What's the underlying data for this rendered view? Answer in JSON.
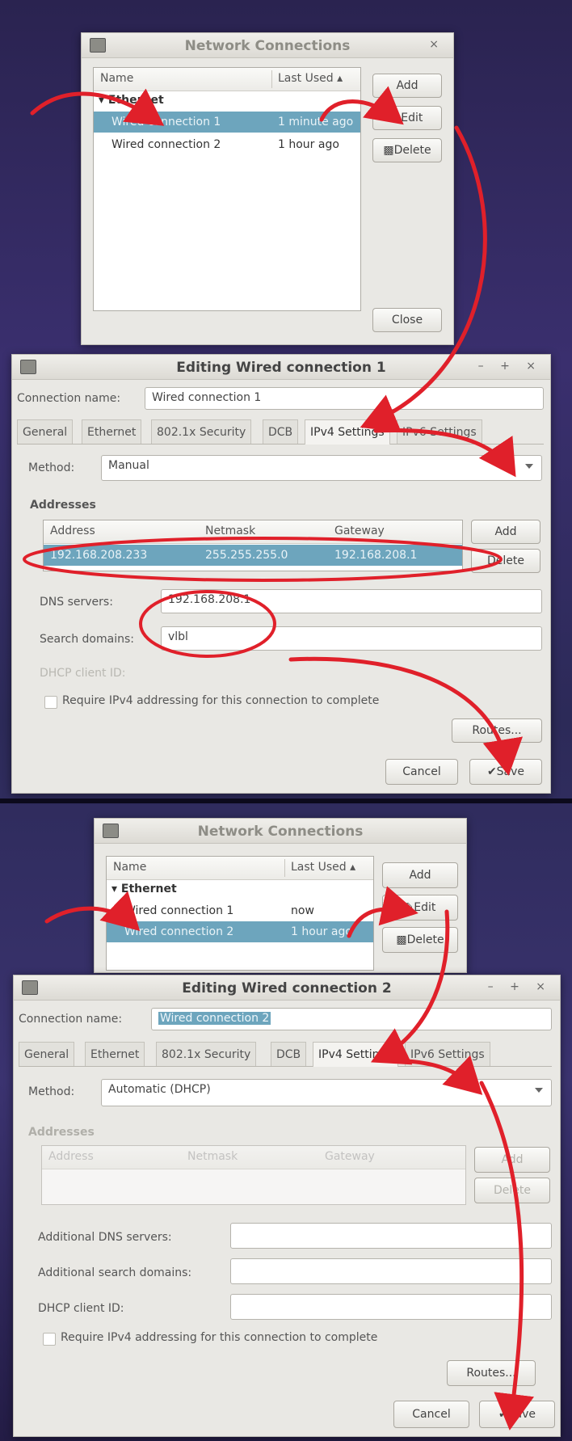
{
  "top": {
    "network_connections": {
      "title": "Network Connections",
      "columns": {
        "name": "Name",
        "last_used": "Last Used ▴"
      },
      "group": "▾ Ethernet",
      "rows": [
        {
          "name": "Wired connection 1",
          "last_used": "1 minute ago",
          "selected": true
        },
        {
          "name": "Wired connection 2",
          "last_used": "1 hour ago",
          "selected": false
        }
      ],
      "buttons": {
        "add": "Add",
        "edit": "Edit",
        "delete": "Delete",
        "close": "Close"
      }
    },
    "editor": {
      "title": "Editing Wired connection 1",
      "connection_name_label": "Connection name:",
      "connection_name_value": "Wired connection 1",
      "tabs": [
        "General",
        "Ethernet",
        "802.1x Security",
        "DCB",
        "IPv4 Settings",
        "IPv6 Settings"
      ],
      "active_tab": "IPv4 Settings",
      "method_label": "Method:",
      "method_value": "Manual",
      "addresses_heading": "Addresses",
      "address_columns": [
        "Address",
        "Netmask",
        "Gateway"
      ],
      "address_row": [
        "192.168.208.233",
        "255.255.255.0",
        "192.168.208.1"
      ],
      "add_button": "Add",
      "delete_button": "Delete",
      "dns_label": "DNS servers:",
      "dns_value": "192.168.208.1",
      "search_label": "Search domains:",
      "search_value": "vlbl",
      "dhcp_label": "DHCP client ID:",
      "require_ipv4": "Require IPv4 addressing for this connection to complete",
      "routes_button": "Routes...",
      "cancel_button": "Cancel",
      "save_button": "✔Save"
    }
  },
  "bottom": {
    "network_connections": {
      "title": "Network Connections",
      "columns": {
        "name": "Name",
        "last_used": "Last Used ▴"
      },
      "group": "▾ Ethernet",
      "rows": [
        {
          "name": "Wired connection 1",
          "last_used": "now",
          "selected": false
        },
        {
          "name": "Wired connection 2",
          "last_used": "1 hour ago",
          "selected": true
        }
      ],
      "buttons": {
        "add": "Add",
        "edit": "Edit",
        "delete": "Delete"
      }
    },
    "editor": {
      "title": "Editing Wired connection 2",
      "connection_name_label": "Connection name:",
      "connection_name_value": "Wired connection 2",
      "tabs": [
        "General",
        "Ethernet",
        "802.1x Security",
        "DCB",
        "IPv4 Settings",
        "IPv6 Settings"
      ],
      "active_tab": "IPv4 Settings",
      "method_label": "Method:",
      "method_value": "Automatic (DHCP)",
      "addresses_heading": "Addresses",
      "address_columns": [
        "Address",
        "Netmask",
        "Gateway"
      ],
      "add_button": "Add",
      "delete_button": "Delete",
      "dns_label": "Additional DNS servers:",
      "search_label": "Additional search domains:",
      "dhcp_label": "DHCP client ID:",
      "require_ipv4": "Require IPv4 addressing for this connection to complete",
      "routes_button": "Routes...",
      "cancel_button": "Cancel",
      "save_button": "✔Save"
    }
  },
  "colors": {
    "selection": "#6da5bd",
    "annotation": "#e0202a",
    "window_bg": "#e9e8e4",
    "desktop": "#2c2a58"
  },
  "icons": [
    "edit-icon",
    "delete-icon",
    "app-icon",
    "window-controls-icon",
    "dropdown-arrow-icon",
    "checkmark-icon"
  ]
}
